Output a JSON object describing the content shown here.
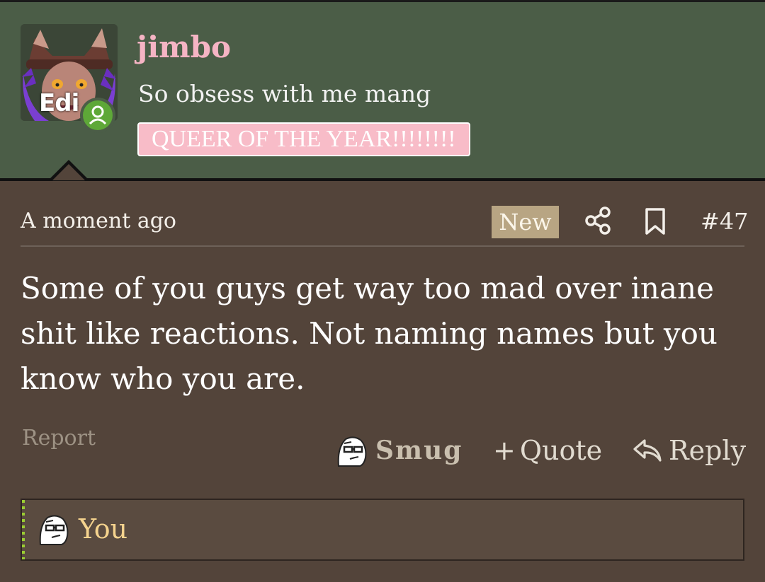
{
  "user": {
    "name": "jimbo",
    "title": "So obsess with me mang",
    "banner": "QUEER OF THE YEAR!!!!!!!!",
    "avatar_overlay_text": "Edi",
    "online": true,
    "colors": {
      "name": "#f5b4c4",
      "banner_bg": "#f8bcc8",
      "header_bg": "#4b5d47",
      "online_dot": "#5ea838"
    }
  },
  "post": {
    "timestamp": "A moment ago",
    "new_badge": "New",
    "number": "#47",
    "body": "Some of you guys get way too mad over inane shit like reactions. Not naming names but you know who you are.",
    "icons": {
      "share": "share-icon",
      "bookmark": "bookmark-icon"
    },
    "colors": {
      "background": "#53443a",
      "new_badge_bg": "#b8a583"
    }
  },
  "actions": {
    "report": "Report",
    "reaction": "Smug",
    "quote_plus": "+",
    "quote": "Quote",
    "reply": "Reply"
  },
  "reactions_summary": {
    "label": "You",
    "icon": "smug-face-icon"
  }
}
